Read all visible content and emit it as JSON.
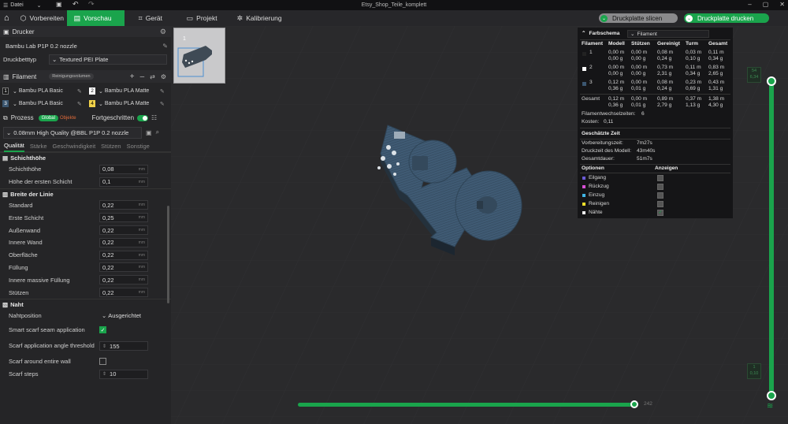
{
  "window": {
    "menu_label": "Datei",
    "title": "Etsy_Shop_Teile_komplett"
  },
  "toolbar": {
    "tabs": [
      {
        "label": "Vorbereiten",
        "icon": "cube-icon"
      },
      {
        "label": "Vorschau",
        "icon": "preview-icon"
      },
      {
        "label": "Gerät",
        "icon": "device-icon"
      },
      {
        "label": "Projekt",
        "icon": "project-icon"
      },
      {
        "label": "Kalibrierung",
        "icon": "calibration-icon"
      }
    ],
    "slice_label": "Druckplatte slicen",
    "print_label": "Druckplatte drucken"
  },
  "printer": {
    "header": "Drucker",
    "name": "Bambu Lab P1P 0.2 nozzle",
    "bed_label": "Druckbetttyp",
    "bed_value": "Textured PEI Plate"
  },
  "filament": {
    "header": "Filament",
    "purge_label": "Reinigungsvolumen",
    "items": [
      {
        "num": "1",
        "name": "Bambu PLA Basic",
        "color": "#111111"
      },
      {
        "num": "2",
        "name": "Bambu PLA Matte",
        "color": "#ffffff"
      },
      {
        "num": "3",
        "name": "Bambu PLA Basic",
        "color": "#3b5670"
      },
      {
        "num": "4",
        "name": "Bambu PLA Matte",
        "color": "#f1d24a"
      }
    ]
  },
  "process": {
    "header": "Prozess",
    "global_label": "Global",
    "objects_label": "Objekte",
    "advanced_label": "Fortgeschritten",
    "profile": "0.08mm High Quality @BBL P1P 0.2 nozzle",
    "tabs": [
      "Qualität",
      "Stärke",
      "Geschwindigkeit",
      "Stützen",
      "Sonstige"
    ]
  },
  "quality": {
    "layer_group": "Schichthöhe",
    "layer_height_label": "Schichthöhe",
    "layer_height": "0,08",
    "first_layer_label": "Höhe der ersten Schicht",
    "first_layer": "0,1",
    "unit": "mm",
    "width_group": "Breite der Linie",
    "widths": [
      {
        "label": "Standard",
        "value": "0,22"
      },
      {
        "label": "Erste Schicht",
        "value": "0,25"
      },
      {
        "label": "Außenwand",
        "value": "0,22"
      },
      {
        "label": "Innere Wand",
        "value": "0,22"
      },
      {
        "label": "Oberfläche",
        "value": "0,22"
      },
      {
        "label": "Füllung",
        "value": "0,22"
      },
      {
        "label": "Innere massive Füllung",
        "value": "0,22"
      },
      {
        "label": "Stützen",
        "value": "0,22"
      }
    ],
    "seam_group": "Naht",
    "seam_pos_label": "Nahtposition",
    "seam_pos": "Ausgerichtet",
    "scarf_label": "Smart scarf seam application",
    "scarf_angle_label": "Scarf application angle threshold",
    "scarf_angle": "155",
    "scarf_wall_label": "Scarf around entire wall",
    "scarf_steps_label": "Scarf steps",
    "scarf_steps": "10"
  },
  "plate": {
    "number": "1"
  },
  "stats": {
    "scheme_label": "Farbschema",
    "scheme_value": "Filament",
    "headers": [
      "Filament",
      "Modell",
      "Stützen",
      "Gereinigt",
      "Turm",
      "Gesamt"
    ],
    "rows": [
      {
        "id": "1",
        "color": "#222222",
        "modell": [
          "0,00 m",
          "0,00 g"
        ],
        "stuetzen": [
          "0,00 m",
          "0,00 g"
        ],
        "gereinigt": [
          "0,08 m",
          "0,24 g"
        ],
        "turm": [
          "0,03 m",
          "0,10 g"
        ],
        "gesamt": [
          "0,11 m",
          "0,34 g"
        ]
      },
      {
        "id": "2",
        "color": "#ffffff",
        "modell": [
          "0,00 m",
          "0,00 g"
        ],
        "stuetzen": [
          "0,00 m",
          "0,00 g"
        ],
        "gereinigt": [
          "0,73 m",
          "2,31 g"
        ],
        "turm": [
          "0,11 m",
          "0,34 g"
        ],
        "gesamt": [
          "0,83 m",
          "2,65 g"
        ]
      },
      {
        "id": "3",
        "color": "#3b5670",
        "modell": [
          "0,12 m",
          "0,36 g"
        ],
        "stuetzen": [
          "0,00 m",
          "0,01 g"
        ],
        "gereinigt": [
          "0,08 m",
          "0,24 g"
        ],
        "turm": [
          "0,23 m",
          "0,69 g"
        ],
        "gesamt": [
          "0,43 m",
          "1,31 g"
        ]
      }
    ],
    "total_label": "Gesamt",
    "total": {
      "modell": [
        "0,12 m",
        "0,36 g"
      ],
      "stuetzen": [
        "0,00 m",
        "0,01 g"
      ],
      "gereinigt": [
        "0,89 m",
        "2,79 g"
      ],
      "turm": [
        "0,37 m",
        "1,13 g"
      ],
      "gesamt": [
        "1,38 m",
        "4,30 g"
      ]
    },
    "changes_label": "Filamentwechselzeiten:",
    "changes": "6",
    "cost_label": "Kosten:",
    "cost": "0,11",
    "time_header": "Geschätzte Zeit",
    "prep_label": "Vorbereitungszeit:",
    "prep": "7m27s",
    "model_time_label": "Druckzeit des Modell:",
    "model_time": "43m40s",
    "total_time_label": "Gesamtdauer:",
    "total_time": "51m7s",
    "options_label": "Optionen",
    "show_label": "Anzeigen",
    "options": [
      {
        "label": "Eilgang",
        "color": "#6b5bd6",
        "checked": false
      },
      {
        "label": "Rückzug",
        "color": "#d84fd6",
        "checked": false
      },
      {
        "label": "Einzug",
        "color": "#3fb5e5",
        "checked": false
      },
      {
        "label": "Reinigen",
        "color": "#f2df2a",
        "checked": false
      },
      {
        "label": "Nähte",
        "color": "#eeeeee",
        "checked": true
      }
    ]
  },
  "layer_slider": {
    "top_label": "54",
    "top_value": "6,34",
    "bottom_label": "1",
    "bottom_value": "0,10",
    "horizontal_value": "242",
    "top_fraction": 1.0,
    "bottom_fraction": 0.0,
    "horizontal_fraction": 1.0
  },
  "colors": {
    "accent": "#1aa44c",
    "model": "#3f5a73"
  }
}
